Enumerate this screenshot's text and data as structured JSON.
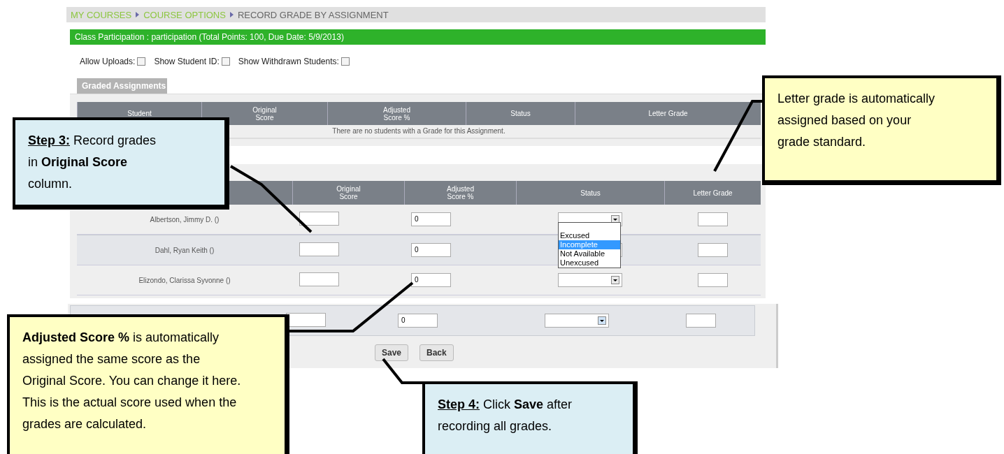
{
  "breadcrumb": [
    {
      "label": "MY COURSES",
      "link": true
    },
    {
      "label": "COURSE OPTIONS",
      "link": true
    },
    {
      "label": "RECORD GRADE BY ASSIGNMENT",
      "link": false
    }
  ],
  "assignment_bar": "Class Participation : participation (Total Points: 100, Due Date: 5/9/2013)",
  "options": [
    {
      "label": "Allow Uploads:",
      "checked": false
    },
    {
      "label": "Show Student ID:",
      "checked": false
    },
    {
      "label": "Show Withdrawn Students:",
      "checked": false
    }
  ],
  "graded_section": {
    "tab": "Graded Assignments",
    "columns": [
      "Student",
      "Original\nScore",
      "Adjusted\nScore %",
      "Status",
      "Letter Grade"
    ],
    "message": "There are no students with a Grade for this Assignment."
  },
  "grading_table": {
    "columns": [
      "Original\nScore",
      "Adjusted\nScore %",
      "Status",
      "Letter Grade"
    ],
    "rows": [
      {
        "student": "Albertson, Jimmy D. ()",
        "adjusted_score": "0",
        "status_options": [
          {
            "label": "Excused",
            "selected": false
          },
          {
            "label": "Incomplete",
            "selected": true
          },
          {
            "label": "Not Available",
            "selected": false
          },
          {
            "label": "Unexcused",
            "selected": false
          }
        ]
      },
      {
        "student": "Dahl, Ryan Keith ()",
        "adjusted_score": "0"
      },
      {
        "student": "Elizondo, Clarissa Syvonne ()",
        "adjusted_score": "0"
      }
    ],
    "partial_row": {
      "adjusted_score": "0"
    }
  },
  "buttons": [
    "Save",
    "Back"
  ],
  "callouts": [
    {
      "text": "**Step 3:** Record grades in **Original Score** column.",
      "color": "#dbeef4",
      "lead_underlined": true
    },
    {
      "text": "Letter grade is automatically assigned based on your grade standard.",
      "color": "#ffffc4"
    },
    {
      "text": "**Adjusted Score %** is automatically assigned the same score as the Original Score. You can change it here. This is the actual score used when the grades are calculated.",
      "color": "#ffffc4"
    },
    {
      "text": "**Step 4:** Click **Save** after recording all grades.",
      "color": "#dbeef4",
      "lead_underlined": true
    }
  ]
}
